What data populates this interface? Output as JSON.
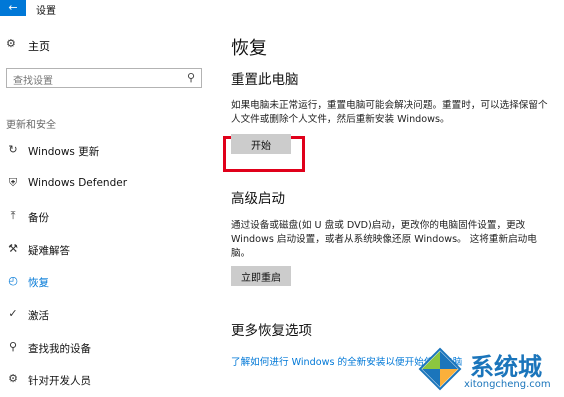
{
  "titlebar": {
    "back_glyph": "←",
    "title": "设置"
  },
  "sidebar": {
    "home": {
      "icon": "gear-icon",
      "label": "主页"
    },
    "search": {
      "placeholder": "查找设置",
      "icon": "search-icon"
    },
    "section_header": "更新和安全",
    "items": [
      {
        "icon": "sync-icon",
        "label": "Windows 更新",
        "active": false
      },
      {
        "icon": "shield-icon",
        "label": "Windows Defender",
        "active": false
      },
      {
        "icon": "backup-arrow-icon",
        "label": "备份",
        "active": false
      },
      {
        "icon": "wrench-icon",
        "label": "疑难解答",
        "active": false
      },
      {
        "icon": "history-icon",
        "label": "恢复",
        "active": true
      },
      {
        "icon": "check-circle-icon",
        "label": "激活",
        "active": false
      },
      {
        "icon": "person-icon",
        "label": "查找我的设备",
        "active": false
      },
      {
        "icon": "developer-icon",
        "label": "针对开发人员",
        "active": false
      }
    ]
  },
  "main": {
    "title": "恢复",
    "reset": {
      "heading": "重置此电脑",
      "description": "如果电脑未正常运行，重置电脑可能会解决问题。重置时，可以选择保留个人文件或删除个人文件，然后重新安装 Windows。",
      "button": "开始"
    },
    "advanced": {
      "heading": "高级启动",
      "description": "通过设备或磁盘(如 U 盘或 DVD)启动，更改你的电脑固件设置，更改 Windows 启动设置，或者从系统映像还原 Windows。 这将重新启动电脑。",
      "button": "立即重启"
    },
    "more": {
      "heading": "更多恢复选项",
      "link": "了解如何进行 Windows 的全新安装以便开始使用电脑"
    }
  },
  "watermark": {
    "text": "系统城",
    "url": "xitongcheng.com"
  },
  "colors": {
    "accent": "#0078d7",
    "highlight": "#e0001a",
    "button_bg": "#cccccc"
  }
}
